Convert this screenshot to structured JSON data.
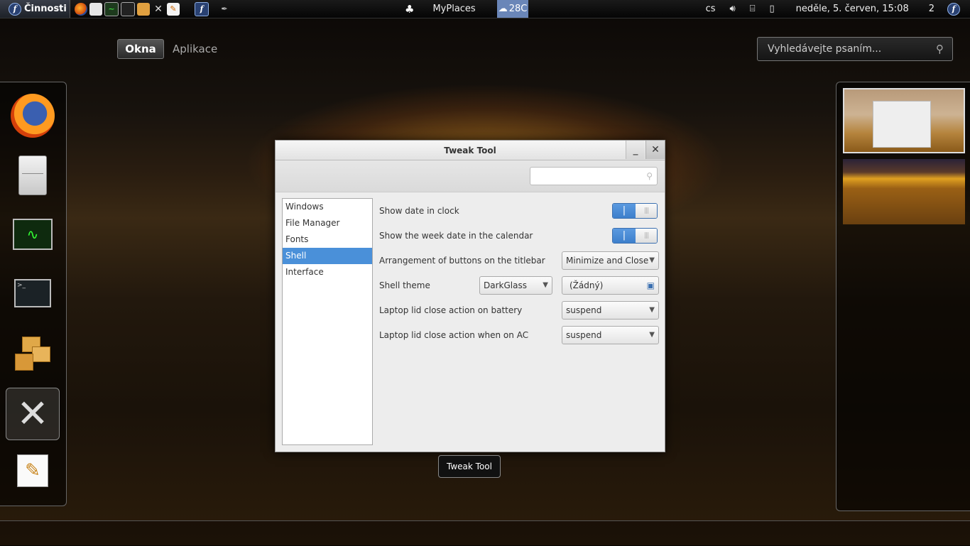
{
  "topbar": {
    "activities_label": "Činnosti",
    "activities_logo": "f",
    "app_title": "MyPlaces",
    "weather_temp": "28C",
    "keyboard_layout": "cs",
    "clock": "neděle,  5. červen, 15:08",
    "workspace_indicator": "2",
    "distro_logo": "f"
  },
  "view_selector": {
    "windows": "Okna",
    "applications": "Aplikace"
  },
  "search": {
    "placeholder": "Vyhledávejte psaním..."
  },
  "window": {
    "title": "Tweak Tool",
    "minimize_glyph": "_",
    "close_glyph": "✕",
    "sidebar": [
      "Windows",
      "File Manager",
      "Fonts",
      "Shell",
      "Interface"
    ],
    "selected": "Shell",
    "settings": {
      "show_date": "Show date in clock",
      "show_week": "Show the week date in the calendar",
      "arrangement": "Arrangement of buttons on the titlebar",
      "arrangement_value": "Minimize and Close",
      "shell_theme": "Shell theme",
      "shell_theme_value": "DarkGlass",
      "shell_theme_file": "(Žádný)",
      "lid_battery": "Laptop lid close action on battery",
      "lid_battery_value": "suspend",
      "lid_ac": "Laptop lid close action when on AC",
      "lid_ac_value": "suspend"
    }
  },
  "tooltip": "Tweak Tool",
  "colors": {
    "accent": "#4a90d9",
    "panel": "#000000"
  }
}
